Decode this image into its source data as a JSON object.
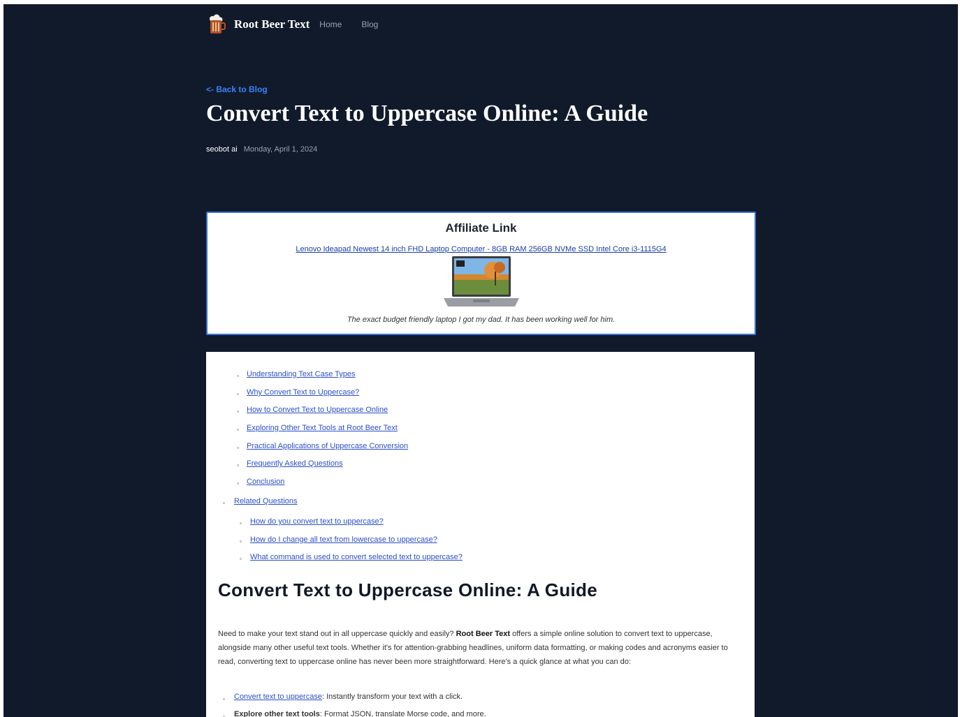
{
  "nav": {
    "brand": "Root Beer Text",
    "links": [
      "Home",
      "Blog"
    ]
  },
  "back_link": "<- Back to Blog",
  "post": {
    "title": "Convert Text to Uppercase Online: A Guide",
    "author": "seobot ai",
    "date": "Monday, April 1, 2024"
  },
  "affiliate": {
    "heading": "Affiliate Link",
    "link_text": "Lenovo Ideapad Newest 14 inch FHD Laptop Computer - 8GB RAM 256GB NVMe SSD Intel Core i3-1115G4",
    "caption": "The exact budget friendly laptop I got my dad. It has been working well for him."
  },
  "toc": {
    "sub_items": [
      "Understanding Text Case Types",
      "Why Convert Text to Uppercase?",
      "How to Convert Text to Uppercase Online",
      "Exploring Other Text Tools at Root Beer Text",
      "Practical Applications of Uppercase Conversion",
      "Frequently Asked Questions",
      "Conclusion"
    ],
    "related": "Related Questions",
    "related_items": [
      "How do you convert text to uppercase?",
      "How do I change all text from lowercase to uppercase?",
      "What command is used to convert selected text to uppercase?"
    ]
  },
  "article": {
    "heading": "Convert Text to Uppercase Online: A Guide",
    "intro_before": "Need to make your text stand out in all uppercase quickly and easily? ",
    "intro_bold": "Root Beer Text",
    "intro_after": " offers a simple online solution to convert text to uppercase, alongside many other useful text tools. Whether it's for attention-grabbing headlines, uniform data formatting, or making codes and acronyms easier to read, converting text to uppercase online has never been more straightforward. Here's a quick glance at what you can do:",
    "list": [
      {
        "link": "Convert text to uppercase",
        "rest": ": Instantly transform your text with a click."
      },
      {
        "bold": "Explore other text tools",
        "rest": ": Format JSON, translate Morse code, and more."
      }
    ]
  }
}
